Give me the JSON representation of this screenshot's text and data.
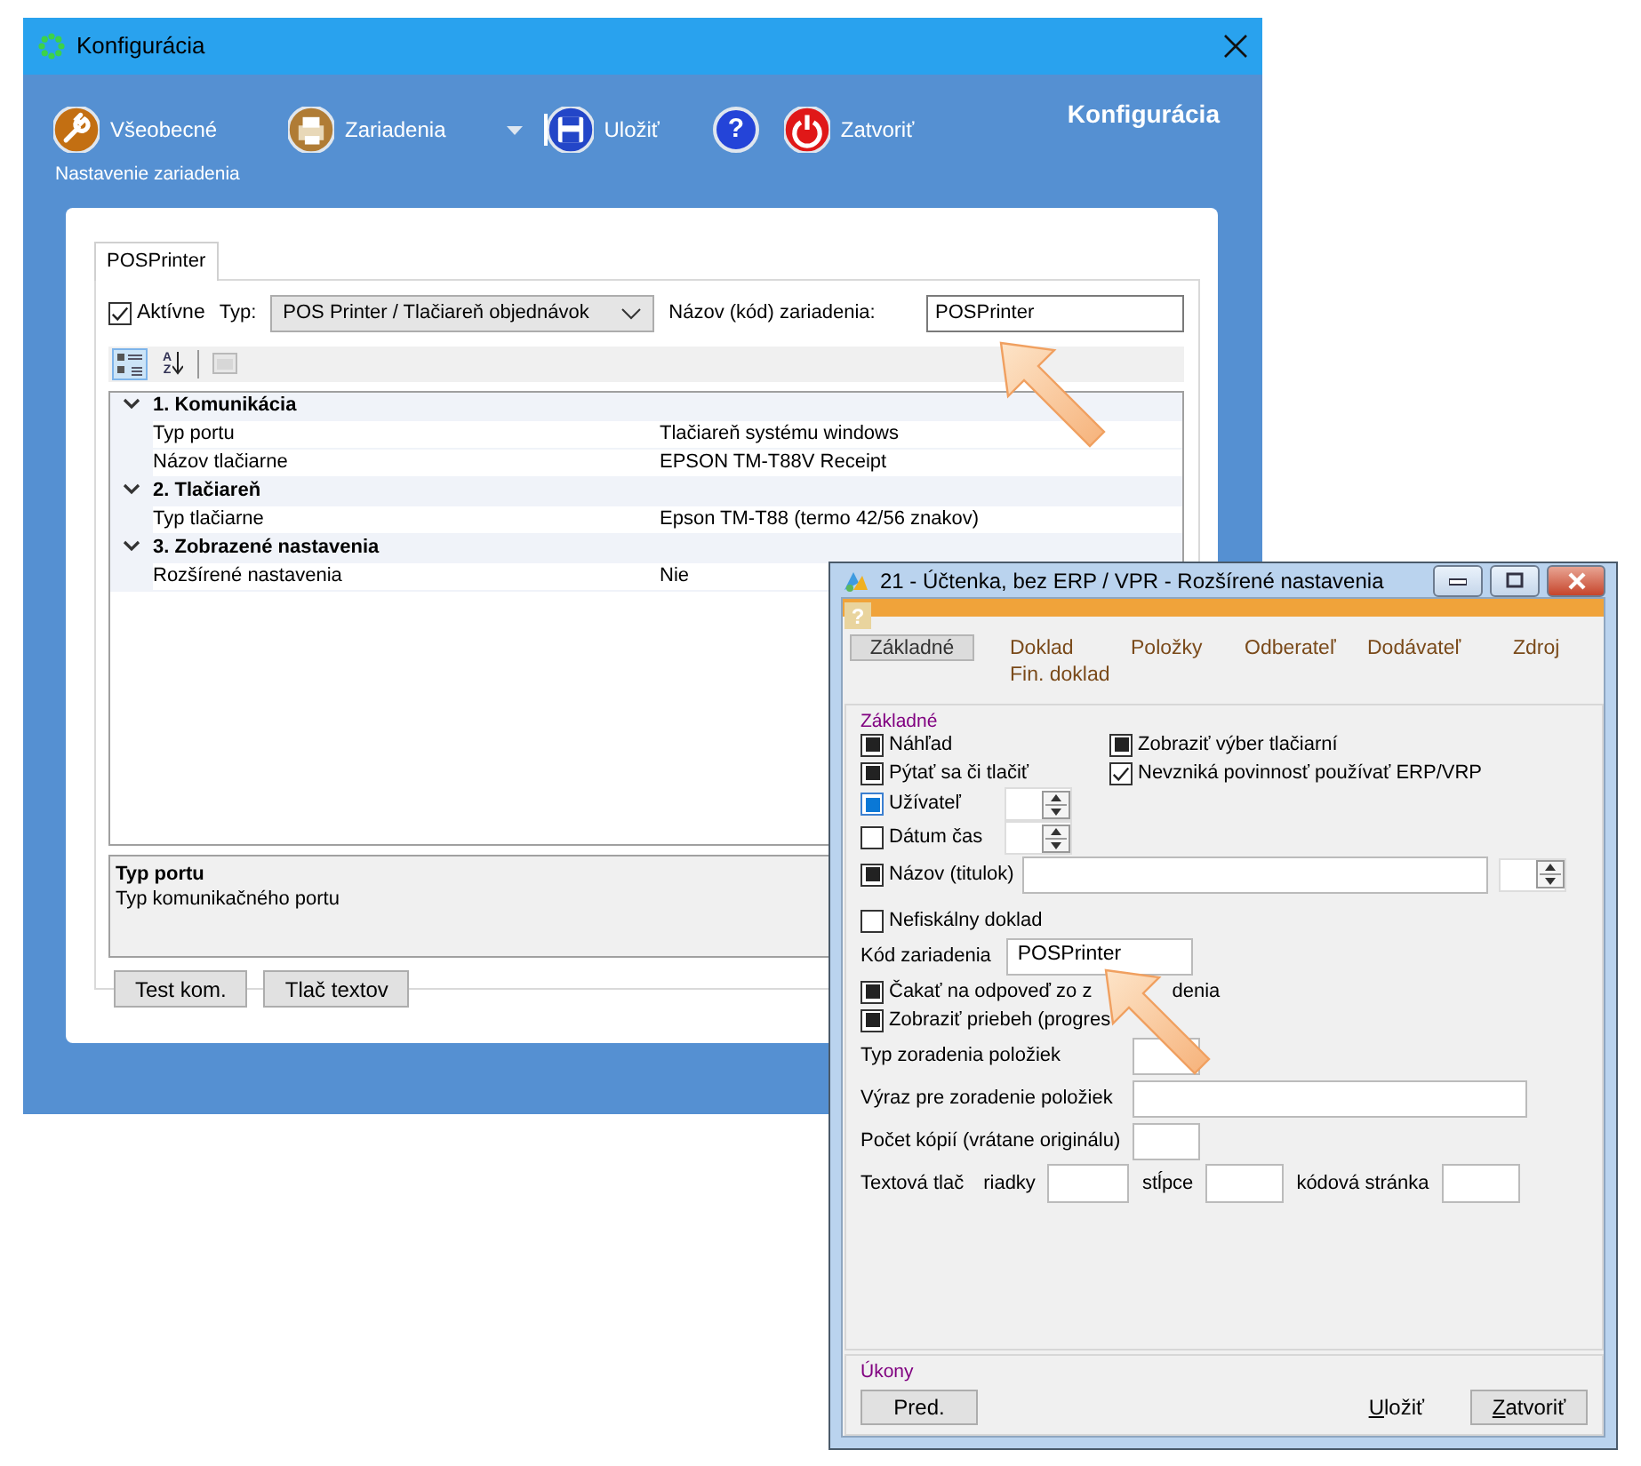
{
  "main_window": {
    "title": "Konfigurácia",
    "toolbar": [
      {
        "kind": "wrench",
        "label": "Všeobecné"
      },
      {
        "kind": "printer",
        "label": "Zariadenia"
      },
      {
        "kind": "caret"
      },
      {
        "kind": "separator"
      },
      {
        "kind": "save",
        "label": "Uložiť"
      },
      {
        "kind": "help",
        "label": "?"
      },
      {
        "kind": "power",
        "label": "Zatvoriť"
      }
    ],
    "heading": "Konfigurácia",
    "subtitle": "Nastavenie zariadenia",
    "tabs": [
      {
        "label": "POSPrinter",
        "selected": true
      }
    ],
    "active": {
      "label": "Aktívne",
      "checked": true
    },
    "type_label": "Typ:",
    "type_value": "POS Printer / Tlačiareň objednávok",
    "name_label": "Názov (kód) zariadenia:",
    "name_value": "POSPrinter",
    "grid_tools": [
      {
        "kind": "categorized",
        "selected": true,
        "disabled": false
      },
      {
        "kind": "alphabetical",
        "letters": [
          "A",
          "Z"
        ],
        "selected": false,
        "disabled": false
      },
      {
        "kind": "pages",
        "selected": false,
        "disabled": true
      }
    ],
    "categories": [
      {
        "title": "1. Komunikácia",
        "expanded": true,
        "properties": [
          {
            "name": "Typ portu",
            "value": "Tlačiareň systému windows"
          },
          {
            "name": "Názov tlačiarne",
            "value": "EPSON TM-T88V Receipt"
          }
        ]
      },
      {
        "title": "2. Tlačiareň",
        "expanded": true,
        "properties": [
          {
            "name": "Typ tlačiarne",
            "value": "Epson TM-T88 (termo 42/56 znakov)"
          }
        ]
      },
      {
        "title": "3. Zobrazené nastavenia",
        "expanded": true,
        "properties": [
          {
            "name": "Rozšírené nastavenia",
            "value": "Nie"
          }
        ]
      }
    ],
    "description": {
      "title": "Typ portu",
      "text": "Typ komunikačného portu"
    },
    "buttons": [
      "Test kom.",
      "Tlač textov"
    ]
  },
  "settings_window": {
    "title": "21 - Účtenka, bez ERP / VPR - Rozšírené nastavenia",
    "help_label": "?",
    "tabs": [
      {
        "label": "Základné",
        "selected": true
      },
      {
        "label": "Doklad",
        "selected": false
      },
      {
        "label": "Položky",
        "selected": false
      },
      {
        "label": "Odberateľ",
        "selected": false
      },
      {
        "label": "Dodávateľ",
        "selected": false
      },
      {
        "label": "Zdroj",
        "selected": false
      },
      {
        "label": "Fin. doklad",
        "selected": false
      }
    ],
    "group_title": "Základné",
    "rows": [
      {
        "items": [
          {
            "kind": "checkbox",
            "label": "Náhľad",
            "checked": false,
            "indeterminate": true,
            "focused": false
          },
          {
            "kind": "checkbox",
            "label": "Zobraziť výber tlačiarní",
            "checked": false,
            "indeterminate": true,
            "focused": false
          }
        ]
      },
      {
        "items": [
          {
            "kind": "checkbox",
            "label": "Pýtať sa či tlačiť",
            "checked": false,
            "indeterminate": true,
            "focused": false
          },
          {
            "kind": "checkbox",
            "label": "Nevzniká povinnosť používať ERP/VRP",
            "checked": true,
            "indeterminate": false,
            "focused": false
          }
        ]
      },
      {
        "items": [
          {
            "kind": "checkbox_spin",
            "label": "Užívateľ",
            "checked": false,
            "indeterminate": true,
            "focused": true
          }
        ]
      },
      {
        "items": [
          {
            "kind": "checkbox_spin",
            "label": "Dátum čas",
            "checked": false,
            "indeterminate": false,
            "focused": false
          }
        ]
      },
      {
        "items": [
          {
            "kind": "checkbox_field_spin",
            "label": "Názov (titulok)",
            "checked": false,
            "indeterminate": true,
            "focused": false
          }
        ]
      },
      {
        "items": [
          {
            "kind": "checkbox",
            "label": "Nefiskálny doklad",
            "checked": false,
            "indeterminate": false,
            "focused": false
          }
        ]
      },
      {
        "items": [
          {
            "kind": "field_inline",
            "label": "Kód zariadenia",
            "value": "POSPrinter"
          }
        ]
      },
      {
        "items": [
          {
            "kind": "checkbox",
            "label": "Čakať na odpoveď zo z",
            "label_after": "denia",
            "checked": false,
            "indeterminate": true,
            "focused": false
          }
        ]
      },
      {
        "items": [
          {
            "kind": "checkbox",
            "label": "Zobraziť priebeh (progres",
            "checked": false,
            "indeterminate": true,
            "focused": false
          }
        ]
      },
      {
        "items": [
          {
            "kind": "field_short",
            "label": "Typ zoradenia položiek"
          }
        ]
      },
      {
        "items": [
          {
            "kind": "field_long",
            "label": "Výraz pre zoradenie položiek"
          }
        ]
      },
      {
        "items": [
          {
            "kind": "field_short",
            "label": "Počet kópií (vrátane originálu)"
          }
        ]
      },
      {
        "items": [
          {
            "kind": "print_size",
            "label": "Textová tlač",
            "fields": [
              "riadky",
              "stĺpce",
              "kódová stránka"
            ]
          }
        ]
      }
    ],
    "actions_title": "Úkony",
    "actions": [
      {
        "label": "Pred.",
        "flat": false,
        "mnemonic": false
      },
      {
        "label": "Uložiť",
        "flat": true,
        "mnemonic": true
      },
      {
        "label": "Zatvoriť",
        "flat": false,
        "mnemonic": true
      }
    ]
  }
}
